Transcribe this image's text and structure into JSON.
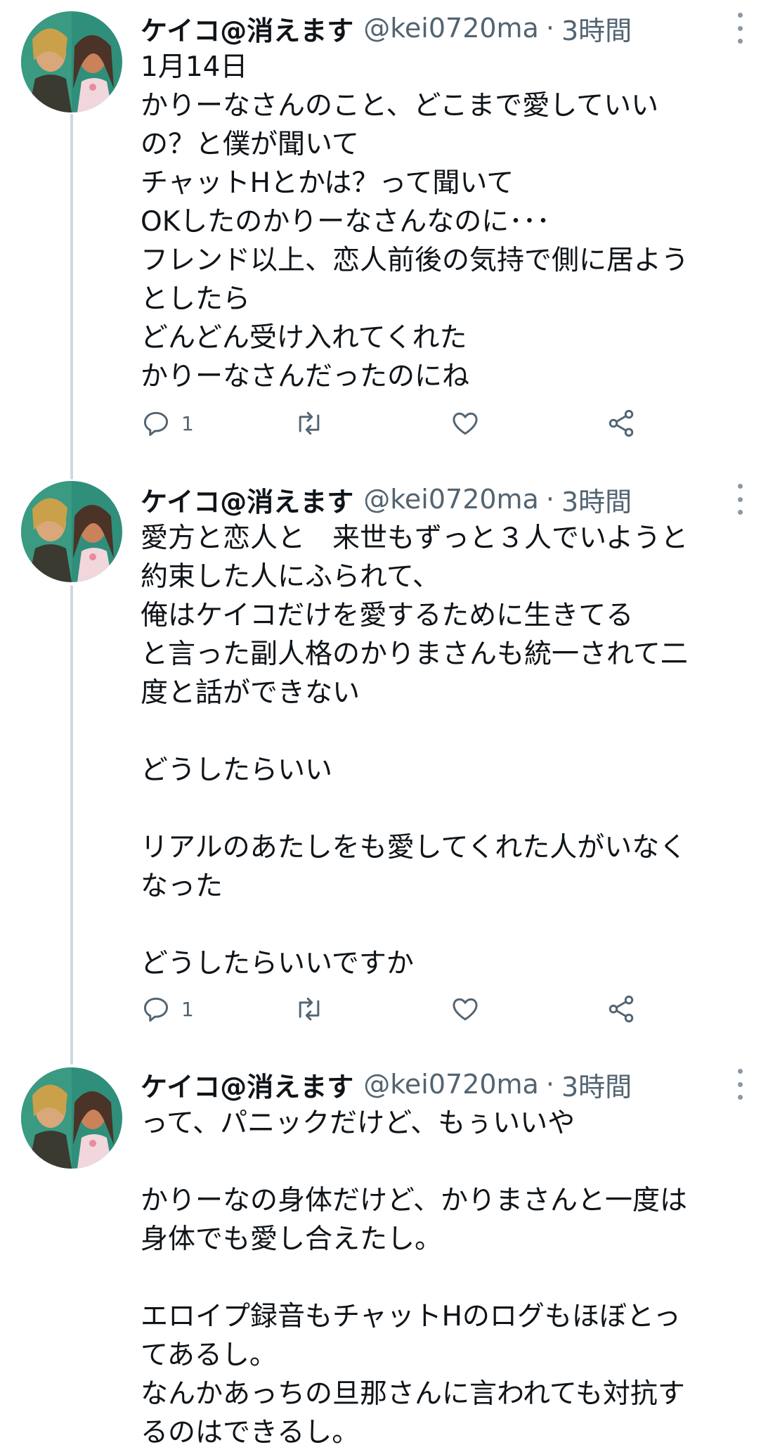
{
  "tweets": [
    {
      "display_name": "ケイコ@消えます",
      "handle": "@kei0720ma",
      "separator": "·",
      "time": "3時間",
      "lines": [
        "1月14日",
        "かりーなさんのこと、どこまで愛していい",
        "の？と僕が聞いて",
        "チャットHとかは？って聞いて",
        "OKしたのかりーなさんなのに･･･",
        "フレンド以上、恋人前後の気持で側に居よう",
        "としたら",
        "どんどん受け入れてくれた",
        "かりーなさんだったのにね"
      ],
      "reply_count": "1",
      "retweet_count": "",
      "like_count": ""
    },
    {
      "display_name": "ケイコ@消えます",
      "handle": "@kei0720ma",
      "separator": "·",
      "time": "3時間",
      "lines": [
        "愛方と恋人と　来世もずっと３人でいようと",
        "約束した人にふられて、",
        "俺はケイコだけを愛するために生きてる",
        "と言った副人格のかりまさんも統一されて二",
        "度と話ができない",
        "",
        "どうしたらいい",
        "",
        "リアルのあたしをも愛してくれた人がいなく",
        "なった",
        "",
        "どうしたらいいですか"
      ],
      "reply_count": "1",
      "retweet_count": "",
      "like_count": ""
    },
    {
      "display_name": "ケイコ@消えます",
      "handle": "@kei0720ma",
      "separator": "·",
      "time": "3時間",
      "lines": [
        "って、パニックだけど、もぅいいや",
        "",
        "かりーなの身体だけど、かりまさんと一度は",
        "身体でも愛し合えたし。",
        "",
        "エロイプ録音もチャットHのログもほぼとっ",
        "てあるし。",
        "なんかあっちの旦那さんに言われても対抗す",
        "るのはできるし。"
      ]
    }
  ],
  "icons": {
    "reply": "reply-icon",
    "retweet": "retweet-icon",
    "like": "heart-icon",
    "share": "share-icon",
    "more": "more-vertical-icon"
  },
  "colors": {
    "text": "#0f1419",
    "secondary": "#536471",
    "thread_line": "#cfd9de",
    "avatar_bg": "#2f8f7a"
  }
}
